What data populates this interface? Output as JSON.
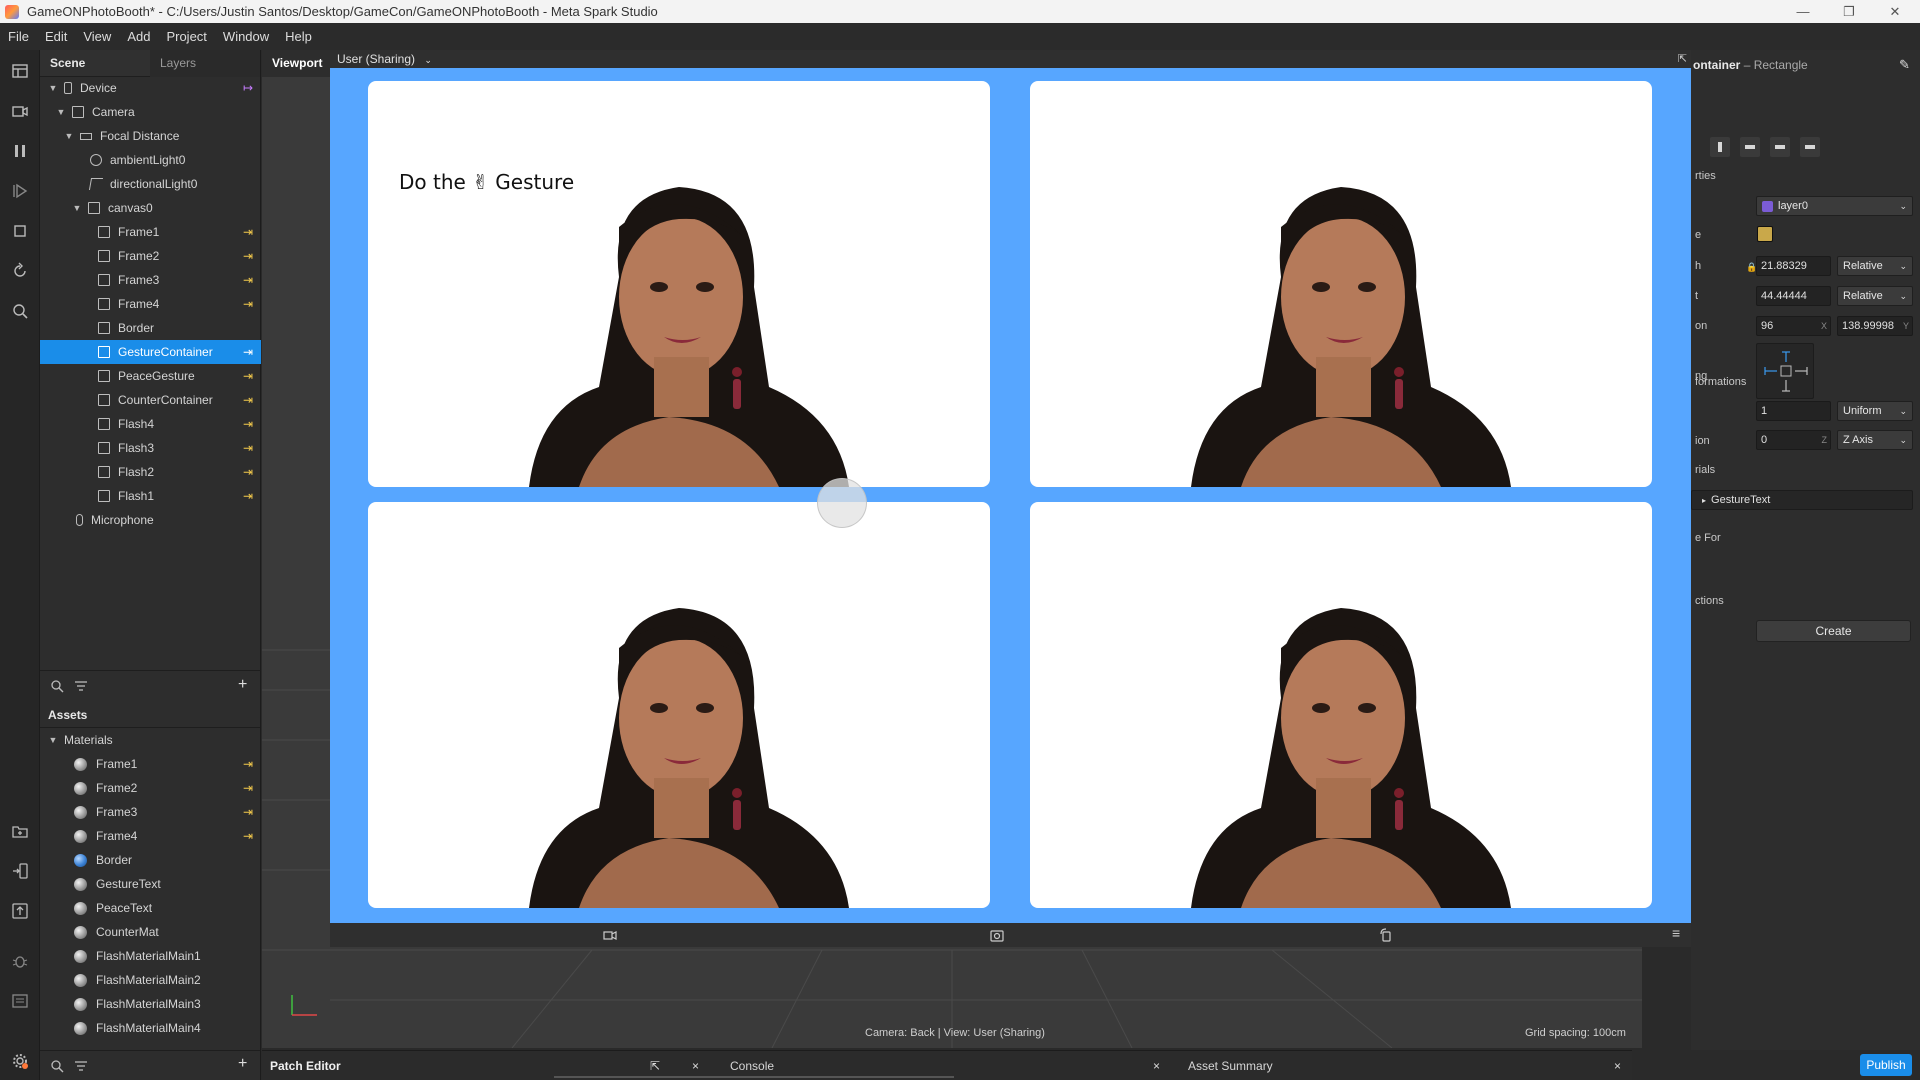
{
  "window": {
    "title": "GameONPhotoBooth* - C:/Users/Justin Santos/Desktop/GameCon/GameONPhotoBooth - Meta Spark Studio",
    "minimize": "—",
    "maximize": "❐",
    "close": "✕"
  },
  "menu": [
    "File",
    "Edit",
    "View",
    "Add",
    "Project",
    "Window",
    "Help"
  ],
  "scene": {
    "tab_scene": "Scene",
    "tab_layers": "Layers",
    "items": [
      {
        "label": "Device"
      },
      {
        "label": "Camera"
      },
      {
        "label": "Focal Distance"
      },
      {
        "label": "ambientLight0"
      },
      {
        "label": "directionalLight0"
      },
      {
        "label": "canvas0"
      },
      {
        "label": "Frame1"
      },
      {
        "label": "Frame2"
      },
      {
        "label": "Frame3"
      },
      {
        "label": "Frame4"
      },
      {
        "label": "Border"
      },
      {
        "label": "GestureContainer"
      },
      {
        "label": "PeaceGesture"
      },
      {
        "label": "CounterContainer"
      },
      {
        "label": "Flash4"
      },
      {
        "label": "Flash3"
      },
      {
        "label": "Flash2"
      },
      {
        "label": "Flash1"
      },
      {
        "label": "Microphone"
      }
    ],
    "selected": "GestureContainer"
  },
  "assets": {
    "title": "Assets",
    "group": "Materials",
    "items": [
      {
        "label": "Frame1"
      },
      {
        "label": "Frame2"
      },
      {
        "label": "Frame3"
      },
      {
        "label": "Frame4"
      },
      {
        "label": "Border"
      },
      {
        "label": "GestureText"
      },
      {
        "label": "PeaceText"
      },
      {
        "label": "CounterMat"
      },
      {
        "label": "FlashMaterialMain1"
      },
      {
        "label": "FlashMaterialMain2"
      },
      {
        "label": "FlashMaterialMain3"
      },
      {
        "label": "FlashMaterialMain4"
      }
    ]
  },
  "viewport": {
    "tab": "Viewport",
    "simulator_user": "User (Sharing)",
    "gesture_text": "Do the ✌ Gesture",
    "camera_status": "Camera: Back | View: User (Sharing)",
    "grid_spacing": "Grid spacing: 100cm"
  },
  "inspector": {
    "title_name": "ontainer",
    "title_type": "– Rectangle",
    "section_properties": "rties",
    "layer_value": "layer0",
    "label_fill": "e",
    "label_width": "h",
    "label_height": "t",
    "label_position": "on",
    "label_pivot": "ng",
    "width_value": "21.88329",
    "width_mode": "Relative",
    "height_value": "44.44444",
    "height_mode": "Relative",
    "pos_x": "96",
    "pos_x_axis": "X",
    "pos_y": "138.99998",
    "pos_y_axis": "Y",
    "section_transformations": "formations",
    "scale_value": "1",
    "scale_mode": "Uniform",
    "label_rotation": "ion",
    "rotation_value": "0",
    "rotation_axis_unit": "Z",
    "rotation_axis": "Z Axis",
    "section_materials": "rials",
    "material_value": "GestureText",
    "section_visible_for": "e For",
    "section_actions": "ctions",
    "create_button": "Create",
    "publish_button": "Publish"
  },
  "bottom": {
    "patch_editor": "Patch Editor",
    "console": "Console",
    "asset_summary": "Asset Summary",
    "close": "×"
  },
  "colors": {
    "accent": "#1a8de9",
    "frame_blue": "#57a6ff",
    "link_yellow": "#f2c94c",
    "layer_purple": "#7b5cd6",
    "fill_swatch": "#c9a84a"
  }
}
